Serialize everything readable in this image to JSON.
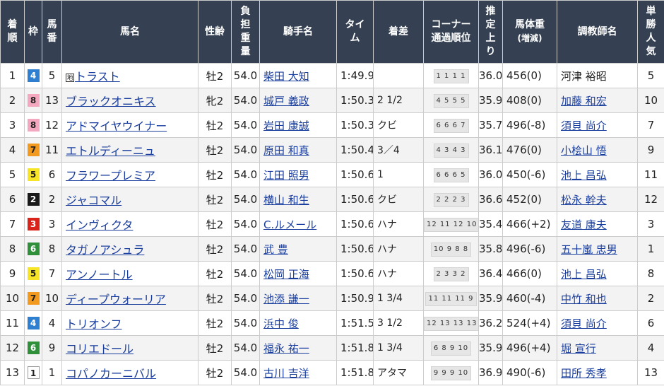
{
  "headers": {
    "finish": "着順",
    "frame": "枠",
    "number": "馬番",
    "horse": "馬名",
    "sexage": "性齢",
    "weight": "負担重量",
    "jockey": "騎手名",
    "time": "タイム",
    "margin": "着差",
    "corner_1": "コーナー",
    "corner_2": "通過順位",
    "last3f": "推定上り",
    "body_1": "馬体重",
    "body_2": "(増減)",
    "trainer": "調教師名",
    "pop": "単勝人気"
  },
  "frame_colors": {
    "1": {
      "bg": "#ffffff",
      "fg": "#222222"
    },
    "2": {
      "bg": "#1a1a1a",
      "fg": "#ffffff"
    },
    "3": {
      "bg": "#d9241c",
      "fg": "#ffffff"
    },
    "4": {
      "bg": "#2f7fd1",
      "fg": "#ffffff"
    },
    "5": {
      "bg": "#f6e526",
      "fg": "#222222"
    },
    "6": {
      "bg": "#2f8f3a",
      "fg": "#ffffff"
    },
    "7": {
      "bg": "#f29a1f",
      "fg": "#222222"
    },
    "8": {
      "bg": "#f3a8c0",
      "fg": "#222222"
    }
  },
  "rows": [
    {
      "finish": "1",
      "frame": "4",
      "number": "5",
      "chi": "地",
      "horse": "トラスト",
      "sexage": "牡2",
      "weight": "54.0",
      "jockey": "柴田 大知",
      "time": "1:49.9",
      "margin": "",
      "corners": "1 1 1 1",
      "last3f": "36.0",
      "body": "456(0)",
      "trainer": "河津 裕昭",
      "trainer_link": false,
      "pop": "5"
    },
    {
      "finish": "2",
      "frame": "8",
      "number": "13",
      "chi": "",
      "horse": "ブラックオニキス",
      "sexage": "牝2",
      "weight": "54.0",
      "jockey": "城戸 義政",
      "time": "1:50.3",
      "margin": "2 1/2",
      "corners": "4 5 5 5",
      "last3f": "35.9",
      "body": "408(0)",
      "trainer": "加藤 和宏",
      "trainer_link": true,
      "pop": "10"
    },
    {
      "finish": "3",
      "frame": "8",
      "number": "12",
      "chi": "",
      "horse": "アドマイヤウイナー",
      "sexage": "牡2",
      "weight": "54.0",
      "jockey": "岩田 康誠",
      "time": "1:50.3",
      "margin": "クビ",
      "corners": "6 6 6 7",
      "last3f": "35.7",
      "body": "496(-8)",
      "trainer": "須貝 尚介",
      "trainer_link": true,
      "pop": "7"
    },
    {
      "finish": "4",
      "frame": "7",
      "number": "11",
      "chi": "",
      "horse": "エトルディーニュ",
      "sexage": "牡2",
      "weight": "54.0",
      "jockey": "原田 和真",
      "time": "1:50.4",
      "margin": "3／4",
      "corners": "4 3 4 3",
      "last3f": "36.1",
      "body": "476(0)",
      "trainer": "小桧山 悟",
      "trainer_link": true,
      "pop": "9"
    },
    {
      "finish": "5",
      "frame": "5",
      "number": "6",
      "chi": "",
      "horse": "フラワープレミア",
      "sexage": "牡2",
      "weight": "54.0",
      "jockey": "江田 照男",
      "time": "1:50.6",
      "margin": "1",
      "corners": "6 6 6 5",
      "last3f": "36.0",
      "body": "450(-6)",
      "trainer": "池上 昌弘",
      "trainer_link": true,
      "pop": "11"
    },
    {
      "finish": "6",
      "frame": "2",
      "number": "2",
      "chi": "",
      "horse": "ジャコマル",
      "sexage": "牡2",
      "weight": "54.0",
      "jockey": "横山 和生",
      "time": "1:50.6",
      "margin": "クビ",
      "corners": "2 2 2 3",
      "last3f": "36.6",
      "body": "452(0)",
      "trainer": "松永 幹夫",
      "trainer_link": true,
      "pop": "12"
    },
    {
      "finish": "7",
      "frame": "3",
      "number": "3",
      "chi": "",
      "horse": "インヴィクタ",
      "sexage": "牡2",
      "weight": "54.0",
      "jockey": "C.ルメール",
      "time": "1:50.6",
      "margin": "ハナ",
      "corners": "12 11 12 10",
      "last3f": "35.4",
      "body": "466(+2)",
      "trainer": "友道 康夫",
      "trainer_link": true,
      "pop": "3"
    },
    {
      "finish": "8",
      "frame": "6",
      "number": "8",
      "chi": "",
      "horse": "タガノアシュラ",
      "sexage": "牡2",
      "weight": "54.0",
      "jockey": "武 豊",
      "time": "1:50.6",
      "margin": "ハナ",
      "corners": "10 9 8 8",
      "last3f": "35.8",
      "body": "496(-6)",
      "trainer": "五十嵐 忠男",
      "trainer_link": true,
      "pop": "1"
    },
    {
      "finish": "9",
      "frame": "5",
      "number": "7",
      "chi": "",
      "horse": "アンノートル",
      "sexage": "牡2",
      "weight": "54.0",
      "jockey": "松岡 正海",
      "time": "1:50.6",
      "margin": "ハナ",
      "corners": "2 3 3 2",
      "last3f": "36.4",
      "body": "466(0)",
      "trainer": "池上 昌弘",
      "trainer_link": true,
      "pop": "8"
    },
    {
      "finish": "10",
      "frame": "7",
      "number": "10",
      "chi": "",
      "horse": "ディープウォーリア",
      "sexage": "牡2",
      "weight": "54.0",
      "jockey": "池添 謙一",
      "time": "1:50.9",
      "margin": "1 3/4",
      "corners": "11 11 11 9",
      "last3f": "35.9",
      "body": "460(-4)",
      "trainer": "中竹 和也",
      "trainer_link": true,
      "pop": "2"
    },
    {
      "finish": "11",
      "frame": "4",
      "number": "4",
      "chi": "",
      "horse": "トリオンフ",
      "sexage": "牡2",
      "weight": "54.0",
      "jockey": "浜中 俊",
      "time": "1:51.5",
      "margin": "3 1/2",
      "corners": "12 13 13 13",
      "last3f": "36.2",
      "body": "524(+4)",
      "trainer": "須貝 尚介",
      "trainer_link": true,
      "pop": "6"
    },
    {
      "finish": "12",
      "frame": "6",
      "number": "9",
      "chi": "",
      "horse": "コリエドール",
      "sexage": "牡2",
      "weight": "54.0",
      "jockey": "福永 祐一",
      "time": "1:51.8",
      "margin": "1 3/4",
      "corners": "6 8 9 10",
      "last3f": "35.9",
      "body": "496(+4)",
      "trainer": "堀 宣行",
      "trainer_link": true,
      "pop": "4"
    },
    {
      "finish": "13",
      "frame": "1",
      "number": "1",
      "chi": "",
      "horse": "コパノカーニバル",
      "sexage": "牡2",
      "weight": "54.0",
      "jockey": "古川 吉洋",
      "time": "1:51.8",
      "margin": "アタマ",
      "corners": "9 9 9 10",
      "last3f": "36.9",
      "body": "490(-6)",
      "trainer": "田所 秀孝",
      "trainer_link": true,
      "pop": "13"
    }
  ]
}
